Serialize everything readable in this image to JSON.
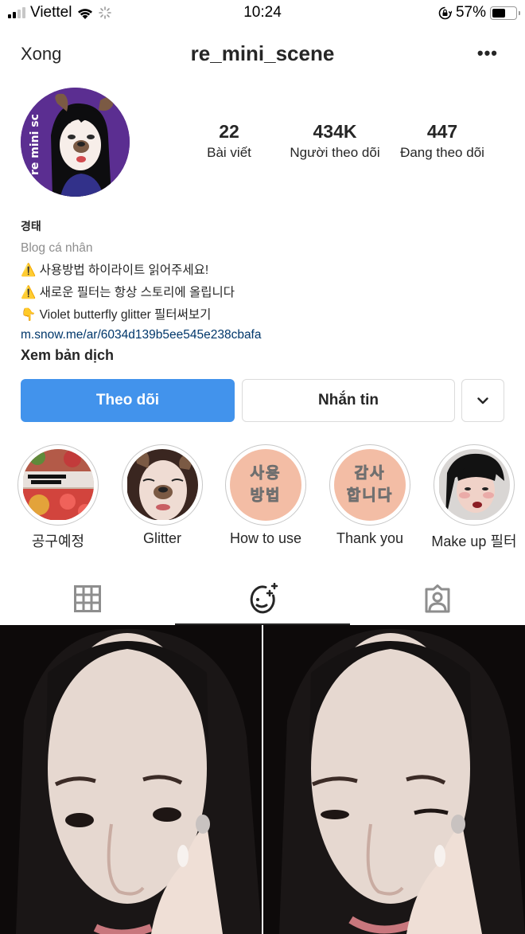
{
  "status_bar": {
    "carrier": "Viettel",
    "time": "10:24",
    "battery_percent": "57%",
    "battery_level": 0.57,
    "signal_bars_active": 2,
    "signal_bars_total": 4
  },
  "nav": {
    "done_label": "Xong",
    "username": "re_mini_scene",
    "more_label": "•••"
  },
  "profile": {
    "avatar_caption": "re mini sc",
    "stats": [
      {
        "value": "22",
        "label": "Bài viết"
      },
      {
        "value": "434K",
        "label": "Người theo dõi"
      },
      {
        "value": "447",
        "label": "Đang theo dõi"
      }
    ],
    "bio": {
      "name": "경태",
      "category": "Blog cá nhân",
      "lines": [
        "⚠️ 사용방법 하이라이트 읽어주세요!",
        "⚠️ 새로운 필터는 항상 스토리에 올립니다",
        "👇 Violet butterfly glitter 필터써보기"
      ],
      "link": "m.snow.me/ar/6034d139b5ee545e238cbafa",
      "translate_label": "Xem bản dịch"
    }
  },
  "actions": {
    "follow_label": "Theo dõi",
    "message_label": "Nhắn tin",
    "follow_color": "#4293ec"
  },
  "highlights": [
    {
      "label": "공구예정",
      "thumb_text": [
        "",
        ""
      ]
    },
    {
      "label": "Glitter",
      "thumb_text": [
        "",
        ""
      ]
    },
    {
      "label": "How to use",
      "thumb_text": [
        "사용",
        "방법"
      ]
    },
    {
      "label": "Thank you",
      "thumb_text": [
        "감사",
        "합니다"
      ]
    },
    {
      "label": "Make up 필터",
      "thumb_text": [
        "",
        ""
      ]
    }
  ],
  "tabs": [
    {
      "name": "grid",
      "icon": "grid-icon",
      "active": false
    },
    {
      "name": "effects",
      "icon": "face-sparkle-icon",
      "active": true
    },
    {
      "name": "tagged",
      "icon": "tagged-person-icon",
      "active": false
    }
  ]
}
